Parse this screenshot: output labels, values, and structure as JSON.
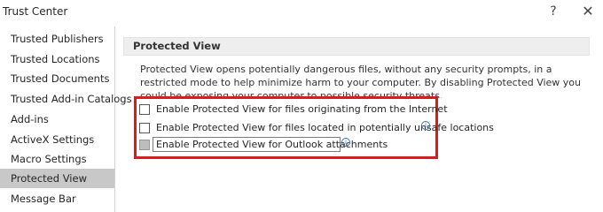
{
  "window": {
    "title": "Trust Center",
    "help_label": "?",
    "close_label": "✕"
  },
  "sidebar": {
    "items": [
      {
        "label": "Trusted Publishers"
      },
      {
        "label": "Trusted Locations"
      },
      {
        "label": "Trusted Documents"
      },
      {
        "label": "Trusted Add-in Catalogs"
      },
      {
        "label": "Add-ins"
      },
      {
        "label": "ActiveX Settings"
      },
      {
        "label": "Macro Settings"
      },
      {
        "label": "Protected View",
        "selected": true
      },
      {
        "label": "Message Bar"
      }
    ]
  },
  "main": {
    "section_title": "Protected View",
    "description": "Protected View opens potentially dangerous files, without any security prompts, in a restricted mode to help minimize harm to your computer. By disabling Protected View you could be exposing your computer to possible security threats.",
    "options": [
      {
        "label": "Enable Protected View for files originating from the Internet",
        "checked": false,
        "disabled": false
      },
      {
        "label": "Enable Protected View for files located in potentially unsafe locations",
        "checked": false,
        "disabled": false,
        "info": "i"
      },
      {
        "label": "Enable Protected View for Outlook attachments",
        "checked": false,
        "disabled": true,
        "info": "i"
      }
    ],
    "highlight_color": "#e01a1a"
  }
}
